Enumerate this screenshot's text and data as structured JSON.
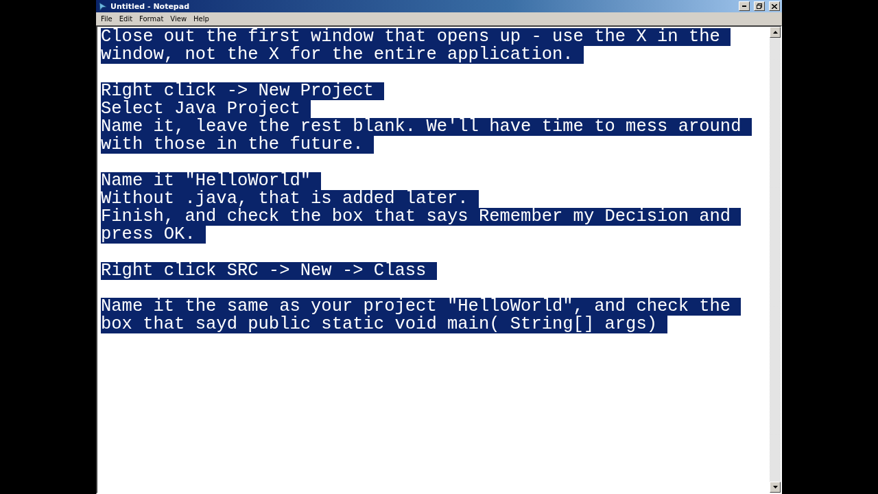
{
  "window": {
    "title": "Untitled - Notepad"
  },
  "menu": [
    "File",
    "Edit",
    "Format",
    "View",
    "Help"
  ],
  "document": {
    "selected": true,
    "paragraphs": [
      [
        "Close out the first window that opens up - use the X in the",
        "window, not the X for the entire application."
      ],
      [
        "Right click -> New Project",
        "Select Java Project",
        "Name it, leave the rest blank. We'll have time to mess around",
        "with those in the future."
      ],
      [
        "Name it \"HelloWorld\"",
        "Without .java, that is added later.",
        "Finish, and check the box that says Remember my Decision and",
        "press OK."
      ],
      [
        "Right click SRC -> New -> Class"
      ],
      [
        "Name it the same as your project \"HelloWorld\", and check the",
        "box that sayd public static void main( String[] args)"
      ]
    ]
  }
}
